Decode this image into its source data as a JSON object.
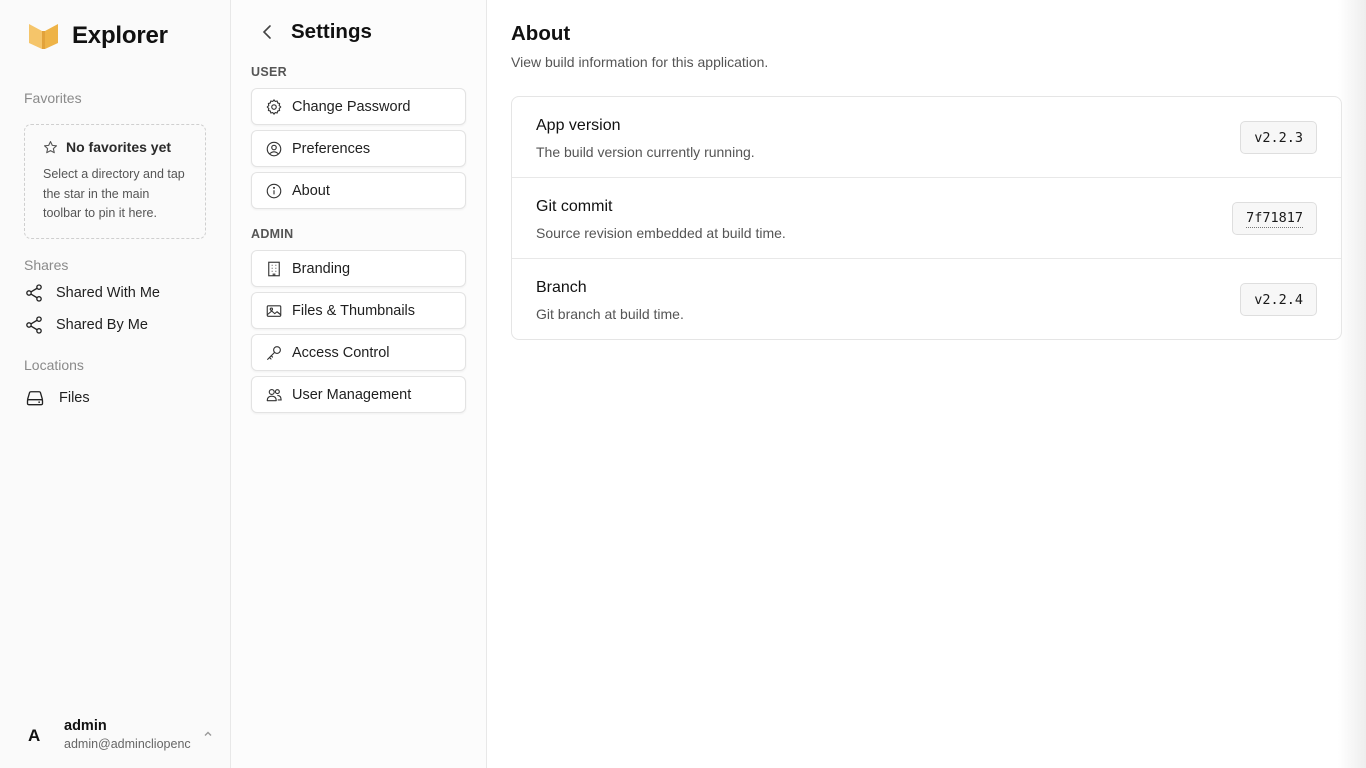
{
  "app": {
    "name": "Explorer",
    "brand_color": "#F2B94B"
  },
  "sidebar": {
    "favorites": {
      "label": "Favorites",
      "empty_title": "No favorites yet",
      "empty_desc": "Select a directory and tap the star in the main toolbar to pin it here."
    },
    "shares": {
      "label": "Shares",
      "items": [
        {
          "label": "Shared With Me",
          "icon": "share-icon"
        },
        {
          "label": "Shared By Me",
          "icon": "share-icon"
        }
      ]
    },
    "locations": {
      "label": "Locations",
      "items": [
        {
          "label": "Files",
          "icon": "drive-icon"
        }
      ]
    },
    "user": {
      "initial": "A",
      "name": "admin",
      "email": "admin@admincliopencloud"
    }
  },
  "settings": {
    "title": "Settings",
    "groups": [
      {
        "label": "USER",
        "items": [
          {
            "label": "Change Password",
            "icon": "gear-icon"
          },
          {
            "label": "Preferences",
            "icon": "user-circle-icon"
          },
          {
            "label": "About",
            "icon": "info-icon"
          }
        ]
      },
      {
        "label": "ADMIN",
        "items": [
          {
            "label": "Branding",
            "icon": "building-icon"
          },
          {
            "label": "Files & Thumbnails",
            "icon": "image-icon"
          },
          {
            "label": "Access Control",
            "icon": "key-icon"
          },
          {
            "label": "User Management",
            "icon": "users-icon"
          }
        ]
      }
    ]
  },
  "main": {
    "title": "About",
    "subtitle": "View build information for this application.",
    "rows": [
      {
        "label": "App version",
        "desc": "The build version currently running.",
        "value": "v2.2.3"
      },
      {
        "label": "Git commit",
        "desc": "Source revision embedded at build time.",
        "value": "7f71817"
      },
      {
        "label": "Branch",
        "desc": "Git branch at build time.",
        "value": "v2.2.4"
      }
    ]
  }
}
